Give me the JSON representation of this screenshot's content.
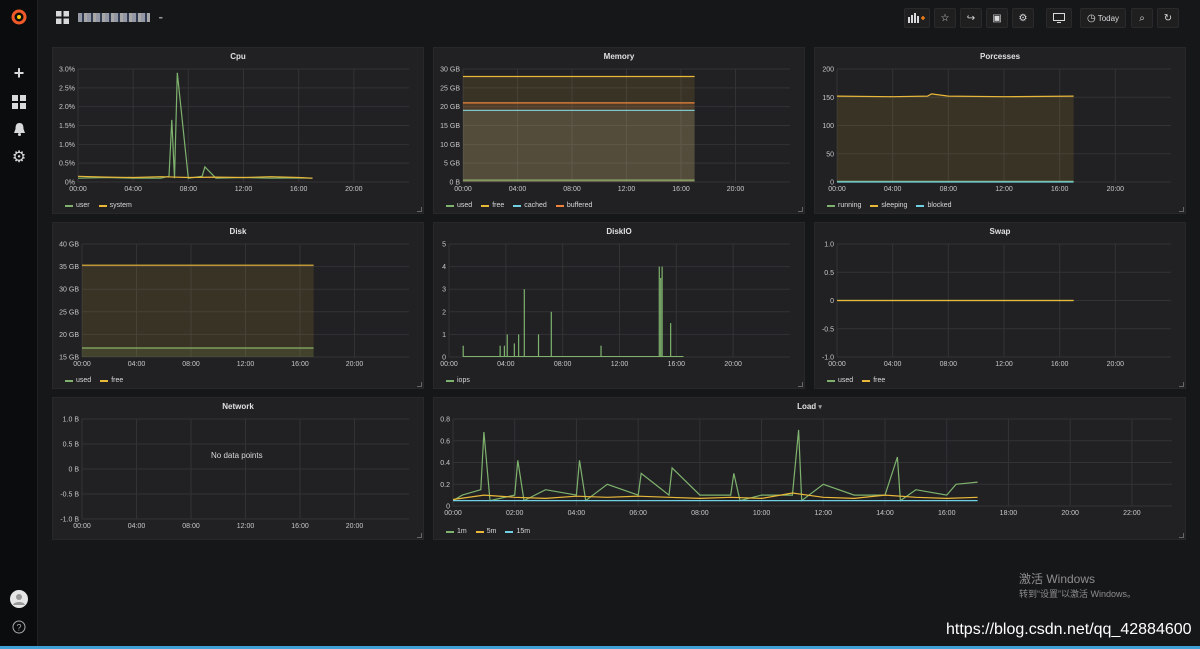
{
  "app": {
    "title": "᷁ᴮᴰᴵ ᴹᴮᴬᴬ",
    "title_display": "     -"
  },
  "sidebar": {
    "items": [
      {
        "name": "grafana-logo-icon",
        "glyph": "☀"
      },
      {
        "name": "plus-icon",
        "glyph": "+"
      },
      {
        "name": "dashboards-icon",
        "glyph": "▦"
      },
      {
        "name": "bell-icon",
        "glyph": "♪"
      },
      {
        "name": "gear-icon",
        "glyph": "⚙"
      }
    ],
    "help_glyph": "?"
  },
  "toolbar": {
    "add_panel_glyph": "▐▌+",
    "star_glyph": "☆",
    "share_glyph": "↪",
    "save_glyph": "▣",
    "settings_glyph": "⚙",
    "tv_glyph": "▭",
    "time_label": "Today",
    "time_glyph": "◷",
    "zoom_glyph": "⌕",
    "refresh_glyph": "↻"
  },
  "colors": {
    "green": "#7eb26d",
    "yellow": "#eab839",
    "cyan": "#6ed0e0",
    "orange": "#ef843c",
    "grid": "#333336",
    "panel": "#212124"
  },
  "chart_data": [
    {
      "id": "cpu",
      "type": "line",
      "title": "Cpu",
      "yticks": [
        "3.0%",
        "2.5%",
        "2.0%",
        "1.5%",
        "1.0%",
        "0.5%",
        "0%"
      ],
      "ylim": [
        0,
        3.0
      ],
      "xticks": [
        "00:00",
        "04:00",
        "08:00",
        "12:00",
        "16:00",
        "20:00"
      ],
      "xlim": [
        0,
        24
      ],
      "series": [
        {
          "name": "user",
          "color": "#7eb26d",
          "x": [
            0,
            2,
            4,
            6,
            6.6,
            6.8,
            7,
            7.2,
            8,
            9,
            9.2,
            10,
            12,
            14,
            16,
            17
          ],
          "y": [
            0.1,
            0.12,
            0.1,
            0.1,
            0.15,
            1.65,
            0.1,
            2.9,
            0.1,
            0.15,
            0.4,
            0.1,
            0.12,
            0.1,
            0.11,
            0.1
          ]
        },
        {
          "name": "system",
          "color": "#eab839",
          "x": [
            0,
            2,
            4,
            6,
            8,
            10,
            12,
            14,
            16,
            17
          ],
          "y": [
            0.15,
            0.13,
            0.12,
            0.14,
            0.12,
            0.13,
            0.12,
            0.14,
            0.12,
            0.1
          ]
        }
      ]
    },
    {
      "id": "memory",
      "type": "area",
      "title": "Memory",
      "yticks": [
        "30 GB",
        "25 GB",
        "20 GB",
        "15 GB",
        "10 GB",
        "5 GB",
        "0 B"
      ],
      "ylim": [
        0,
        30
      ],
      "xticks": [
        "00:00",
        "04:00",
        "08:00",
        "12:00",
        "16:00",
        "20:00"
      ],
      "xlim": [
        0,
        24
      ],
      "series": [
        {
          "name": "used",
          "color": "#7eb26d",
          "x": [
            0,
            17
          ],
          "y": [
            0.5,
            0.5
          ]
        },
        {
          "name": "free",
          "color": "#eab839",
          "x": [
            0,
            17
          ],
          "y": [
            28,
            28
          ]
        },
        {
          "name": "cached",
          "color": "#6ed0e0",
          "x": [
            0,
            17
          ],
          "y": [
            19,
            19
          ]
        },
        {
          "name": "buffered",
          "color": "#ef843c",
          "x": [
            0,
            17
          ],
          "y": [
            21,
            21
          ]
        }
      ]
    },
    {
      "id": "processes",
      "type": "area",
      "title": "Porcesses",
      "yticks": [
        "200",
        "150",
        "100",
        "50",
        "0"
      ],
      "ylim": [
        0,
        200
      ],
      "xticks": [
        "00:00",
        "04:00",
        "08:00",
        "12:00",
        "16:00",
        "20:00"
      ],
      "xlim": [
        0,
        24
      ],
      "series": [
        {
          "name": "running",
          "color": "#7eb26d",
          "x": [
            0,
            17
          ],
          "y": [
            1,
            1
          ]
        },
        {
          "name": "sleeping",
          "color": "#eab839",
          "x": [
            0,
            4,
            6.5,
            6.8,
            8,
            12,
            17
          ],
          "y": [
            152,
            151,
            152,
            156,
            152,
            151,
            152
          ]
        },
        {
          "name": "blocked",
          "color": "#6ed0e0",
          "x": [
            0,
            17
          ],
          "y": [
            0,
            0
          ]
        }
      ]
    },
    {
      "id": "disk",
      "type": "area",
      "title": "Disk",
      "yticks": [
        "40 GB",
        "35 GB",
        "30 GB",
        "25 GB",
        "20 GB",
        "15 GB"
      ],
      "ylim": [
        15,
        40
      ],
      "xticks": [
        "00:00",
        "04:00",
        "08:00",
        "12:00",
        "16:00",
        "20:00"
      ],
      "xlim": [
        0,
        24
      ],
      "series": [
        {
          "name": "used",
          "color": "#7eb26d",
          "x": [
            0,
            17
          ],
          "y": [
            17,
            17
          ]
        },
        {
          "name": "free",
          "color": "#eab839",
          "x": [
            0,
            17
          ],
          "y": [
            35.3,
            35.3
          ]
        }
      ]
    },
    {
      "id": "diskio",
      "type": "bar",
      "title": "DiskIO",
      "yticks": [
        "5",
        "4",
        "3",
        "2",
        "1",
        "0"
      ],
      "ylim": [
        0,
        5
      ],
      "xticks": [
        "00:00",
        "04:00",
        "08:00",
        "12:00",
        "16:00",
        "20:00"
      ],
      "xlim": [
        0,
        24
      ],
      "series": [
        {
          "name": "iops",
          "color": "#7eb26d",
          "x": [
            1,
            3.6,
            3.9,
            4.1,
            4.6,
            4.9,
            5.3,
            6.3,
            7.2,
            10.7,
            14.8,
            14.9,
            15.0,
            15.6
          ],
          "y": [
            0.5,
            0.5,
            0.5,
            1.0,
            0.6,
            1.0,
            3.0,
            1.0,
            2.0,
            0.5,
            4.0,
            3.5,
            4.0,
            1.5
          ]
        }
      ]
    },
    {
      "id": "swap",
      "type": "line",
      "title": "Swap",
      "yticks": [
        "1.0",
        "0.5",
        "0",
        "-0.5",
        "-1.0"
      ],
      "ylim": [
        -1,
        1
      ],
      "xticks": [
        "00:00",
        "04:00",
        "08:00",
        "12:00",
        "16:00",
        "20:00"
      ],
      "xlim": [
        0,
        24
      ],
      "series": [
        {
          "name": "used",
          "color": "#7eb26d",
          "x": [
            0,
            17
          ],
          "y": [
            0,
            0
          ]
        },
        {
          "name": "free",
          "color": "#eab839",
          "x": [
            0,
            17
          ],
          "y": [
            0,
            0
          ]
        }
      ]
    },
    {
      "id": "network",
      "type": "line",
      "title": "Network",
      "yticks": [
        "1.0 B",
        "0.5 B",
        "0 B",
        "-0.5 B",
        "-1.0 B"
      ],
      "ylim": [
        -1,
        1
      ],
      "xticks": [
        "00:00",
        "04:00",
        "08:00",
        "12:00",
        "16:00",
        "20:00"
      ],
      "xlim": [
        0,
        24
      ],
      "nodata": "No data points",
      "series": []
    },
    {
      "id": "load",
      "type": "line",
      "title": "Load",
      "yticks": [
        "0.8",
        "0.6",
        "0.4",
        "0.2",
        "0"
      ],
      "ylim": [
        0,
        0.8
      ],
      "xticks": [
        "00:00",
        "02:00",
        "04:00",
        "06:00",
        "08:00",
        "10:00",
        "12:00",
        "14:00",
        "16:00",
        "18:00",
        "20:00",
        "22:00"
      ],
      "xlim": [
        0,
        23.3
      ],
      "series": [
        {
          "name": "1m",
          "color": "#7eb26d",
          "x": [
            0,
            0.3,
            0.9,
            1.0,
            1.2,
            2.0,
            2.1,
            2.3,
            3.0,
            4.0,
            4.1,
            4.3,
            5.0,
            6.0,
            6.1,
            7.0,
            7.1,
            8.0,
            9.0,
            9.1,
            9.3,
            10.0,
            11.0,
            11.2,
            11.3,
            12.0,
            13.0,
            14.0,
            14.4,
            14.5,
            15.0,
            16.0,
            16.3,
            17.0
          ],
          "y": [
            0.05,
            0.1,
            0.15,
            0.68,
            0.05,
            0.1,
            0.42,
            0.05,
            0.15,
            0.1,
            0.42,
            0.05,
            0.2,
            0.1,
            0.3,
            0.1,
            0.35,
            0.1,
            0.1,
            0.3,
            0.05,
            0.1,
            0.1,
            0.7,
            0.05,
            0.2,
            0.1,
            0.1,
            0.45,
            0.05,
            0.15,
            0.1,
            0.2,
            0.22
          ]
        },
        {
          "name": "5m",
          "color": "#eab839",
          "x": [
            0,
            1,
            2,
            3,
            4,
            5,
            6,
            7,
            8,
            9,
            10,
            11,
            12,
            13,
            14,
            15,
            16,
            17
          ],
          "y": [
            0.06,
            0.1,
            0.08,
            0.07,
            0.09,
            0.08,
            0.09,
            0.08,
            0.07,
            0.08,
            0.07,
            0.12,
            0.08,
            0.07,
            0.1,
            0.08,
            0.07,
            0.08
          ]
        },
        {
          "name": "15m",
          "color": "#6ed0e0",
          "x": [
            0,
            17
          ],
          "y": [
            0.05,
            0.05
          ]
        }
      ]
    }
  ]
}
